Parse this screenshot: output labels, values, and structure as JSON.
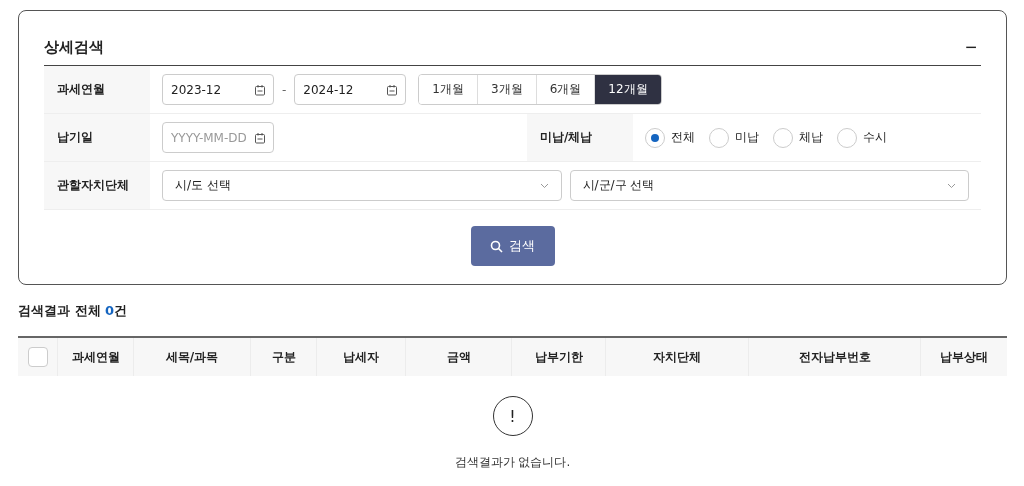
{
  "panel": {
    "title": "상세검색",
    "collapse": "−"
  },
  "filters": {
    "period": {
      "label": "과세연월",
      "from": "2023-12",
      "separator": "-",
      "to": "2024-12",
      "ranges": [
        {
          "label": "1개월",
          "selected": false
        },
        {
          "label": "3개월",
          "selected": false
        },
        {
          "label": "6개월",
          "selected": false
        },
        {
          "label": "12개월",
          "selected": true
        }
      ]
    },
    "due": {
      "label": "납기일",
      "placeholder": "YYYY-MM-DD"
    },
    "status": {
      "label": "미납/체납",
      "options": [
        {
          "label": "전체",
          "selected": true
        },
        {
          "label": "미납",
          "selected": false
        },
        {
          "label": "체납",
          "selected": false
        },
        {
          "label": "수시",
          "selected": false
        }
      ]
    },
    "region": {
      "label": "관할자치단체",
      "province": "시/도 선택",
      "district": "시/군/구 선택"
    }
  },
  "search_button": "검색",
  "results": {
    "label": "검색결과 전체",
    "count": "0",
    "unit": "건",
    "select_all_checked": false,
    "columns": [
      "과세연월",
      "세목/과목",
      "구분",
      "납세자",
      "금액",
      "납부기한",
      "자치단체",
      "전자납부번호",
      "납부상태"
    ],
    "empty_mark": "!",
    "empty_message": "검색결과가 없습니다."
  }
}
